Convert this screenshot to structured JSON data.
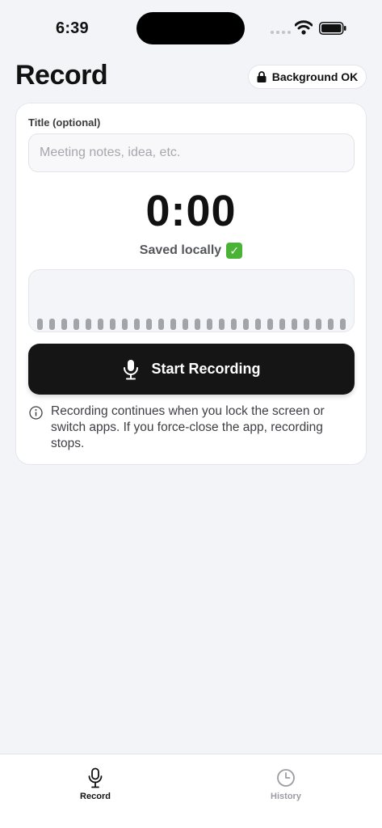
{
  "status_bar": {
    "time": "6:39"
  },
  "header": {
    "title": "Record",
    "badge_label": "Background OK"
  },
  "card": {
    "title_label": "Title (optional)",
    "title_input": {
      "value": "",
      "placeholder": "Meeting notes, idea, etc."
    },
    "timer": "0:00",
    "saved_text": "Saved locally",
    "saved_emoji": "✓",
    "start_button_label": "Start Recording",
    "info_text": "Recording continues when you lock the screen or switch apps. If you force-close the app, recording stops."
  },
  "tab_bar": {
    "tabs": [
      {
        "label": "Record",
        "icon": "mic-icon",
        "active": true
      },
      {
        "label": "History",
        "icon": "clock-icon",
        "active": false
      }
    ]
  },
  "colors": {
    "accent": "#151515",
    "background": "#f3f4f8",
    "success": "#4ab335",
    "inactive": "#9c9da3"
  }
}
